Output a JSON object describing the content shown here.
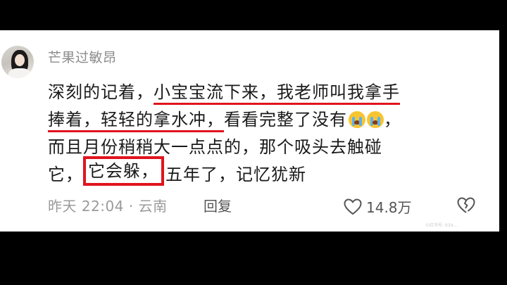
{
  "comment": {
    "username": "芒果过敏昂",
    "text": {
      "line1_prefix": "深刻的记着，",
      "line1_underlined": "小宝宝流下来，我老师叫我拿手",
      "line2_underlined": "捧着，轻轻的拿水冲，",
      "line2_suffix": "看看完整了没有",
      "line3": "而且月份稍稍大一点点的，那个吸头去触碰",
      "line4_prefix": "它，",
      "line4_boxed": "它会躲，",
      "line4_suffix": "五年了，记忆犹新"
    },
    "emojis": [
      "crying-face-icon",
      "crying-face-icon"
    ],
    "trailing_comma": "，",
    "timestamp_location": "昨天 22:04 · 云南",
    "reply_label": "回复",
    "like_count": "14.8万",
    "watermark": "小红书号: 934..."
  },
  "colors": {
    "highlight": "#e0141e",
    "username": "#8c8c8c",
    "text": "#1a1a1a",
    "meta": "#9a9a9a"
  }
}
